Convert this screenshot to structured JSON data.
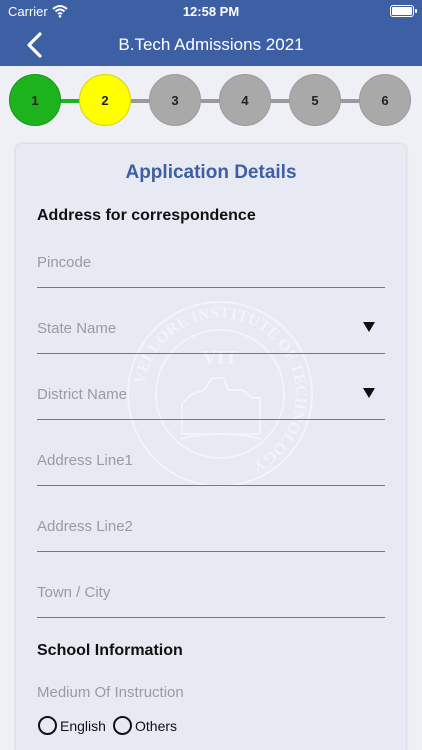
{
  "status_bar": {
    "carrier": "Carrier",
    "time": "12:58 PM"
  },
  "nav": {
    "title": "B.Tech Admissions 2021"
  },
  "steps": [
    "1",
    "2",
    "3",
    "4",
    "5",
    "6"
  ],
  "form": {
    "heading": "Application Details",
    "address_section": "Address for correspondence",
    "fields": {
      "pincode": "Pincode",
      "state": "State Name",
      "district": "District Name",
      "address1": "Address Line1",
      "address2": "Address Line2",
      "town": "Town / City"
    },
    "school_section": "School Information",
    "medium_label": "Medium Of Instruction",
    "medium_options": [
      "English",
      "Others"
    ]
  },
  "watermark": {
    "initials": "VIT",
    "ring_text": "VELLORE INSTITUTE OF TECHNOLOGY"
  },
  "colors": {
    "primary": "#3d5fa3",
    "step_done": "#1db31d",
    "step_current": "#ffff00",
    "step_pending": "#a9a9a9"
  }
}
